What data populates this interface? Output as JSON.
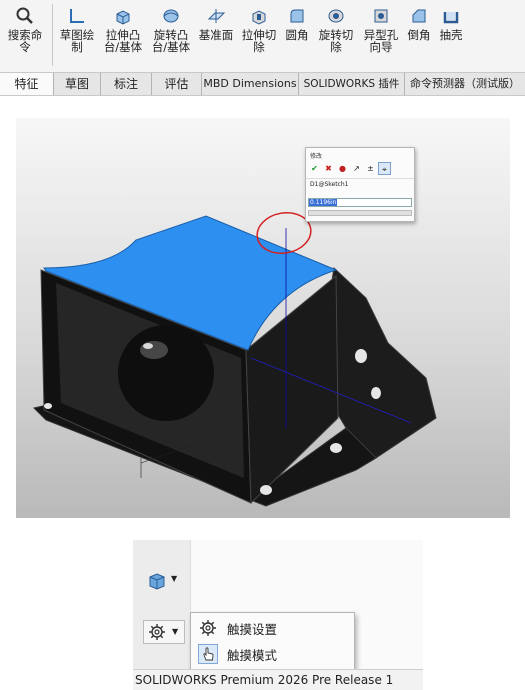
{
  "ribbon": {
    "buttons": [
      {
        "label": "搜索命\n令",
        "icon": "search-icon"
      },
      {
        "label": "草图绘\n制",
        "icon": "sketch-icon"
      },
      {
        "label": "拉伸凸\n台/基体",
        "icon": "extruded-boss-icon"
      },
      {
        "label": "旋转凸\n台/基体",
        "icon": "revolved-boss-icon"
      },
      {
        "label": "基准面",
        "icon": "reference-plane-icon"
      },
      {
        "label": "拉伸切\n除",
        "icon": "extruded-cut-icon"
      },
      {
        "label": "圆角",
        "icon": "fillet-icon"
      },
      {
        "label": "旋转切\n除",
        "icon": "revolved-cut-icon"
      },
      {
        "label": "异型孔\n向导",
        "icon": "hole-wizard-icon"
      },
      {
        "label": "倒角",
        "icon": "chamfer-icon"
      },
      {
        "label": "抽壳",
        "icon": "shell-icon"
      }
    ]
  },
  "tabs": [
    {
      "label": "特征",
      "active": true
    },
    {
      "label": "草图",
      "active": false
    },
    {
      "label": "标注",
      "active": false
    },
    {
      "label": "评估",
      "active": false
    },
    {
      "label": "MBD Dimensions",
      "active": false
    },
    {
      "label": "SOLIDWORKS 插件",
      "active": false
    },
    {
      "label": "命令预测器（测试版）",
      "active": false
    }
  ],
  "modify_popup": {
    "title": "修改",
    "sketch_name": "D1@Sketch1",
    "value": "0.1196in",
    "buttons": [
      "ok-check-icon",
      "cancel-x-icon",
      "rebuild-icon",
      "reverse-icon",
      "mark-dimension-icon",
      "pin-icon"
    ]
  },
  "colors": {
    "accent_blue": "#2d8ff0",
    "part_body": "#1e1e1e",
    "dimension_red_circle": "#d42020"
  },
  "context_menu": {
    "items": [
      {
        "label": "触摸设置",
        "icon": "gear-icon"
      },
      {
        "label": "触摸模式",
        "icon": "touch-hand-icon"
      }
    ]
  },
  "toolbar_left": {
    "view_button_icon": "cube-icon",
    "settings_button_icon": "gear-icon"
  },
  "status_bar": {
    "text": "SOLIDWORKS Premium 2026 Pre Release 1"
  }
}
